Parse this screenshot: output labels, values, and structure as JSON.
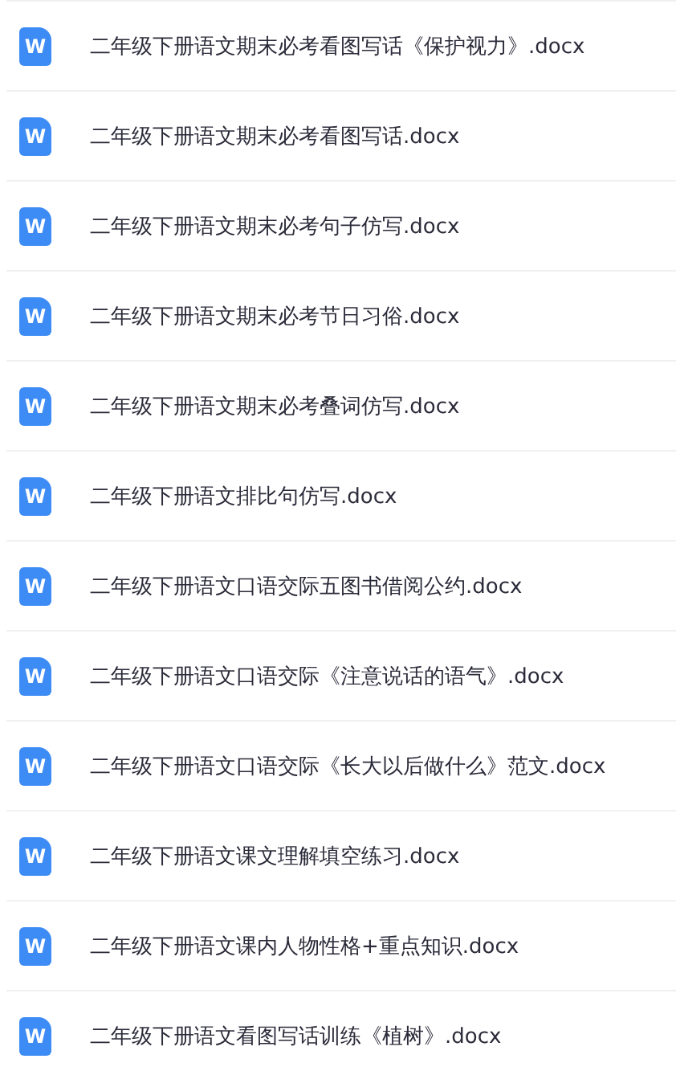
{
  "files": [
    {
      "icon_label": "W",
      "name": "二年级下册语文期末必考看图写话《保护视力》.docx"
    },
    {
      "icon_label": "W",
      "name": "二年级下册语文期末必考看图写话.docx"
    },
    {
      "icon_label": "W",
      "name": "二年级下册语文期末必考句子仿写.docx"
    },
    {
      "icon_label": "W",
      "name": "二年级下册语文期末必考节日习俗.docx"
    },
    {
      "icon_label": "W",
      "name": "二年级下册语文期末必考叠词仿写.docx"
    },
    {
      "icon_label": "W",
      "name": "二年级下册语文排比句仿写.docx"
    },
    {
      "icon_label": "W",
      "name": "二年级下册语文口语交际五图书借阅公约.docx"
    },
    {
      "icon_label": "W",
      "name": "二年级下册语文口语交际《注意说话的语气》.docx"
    },
    {
      "icon_label": "W",
      "name": "二年级下册语文口语交际《长大以后做什么》范文.docx"
    },
    {
      "icon_label": "W",
      "name": "二年级下册语文课文理解填空练习.docx"
    },
    {
      "icon_label": "W",
      "name": "二年级下册语文课内人物性格+重点知识.docx"
    },
    {
      "icon_label": "W",
      "name": "二年级下册语文看图写话训练《植树》.docx"
    }
  ]
}
